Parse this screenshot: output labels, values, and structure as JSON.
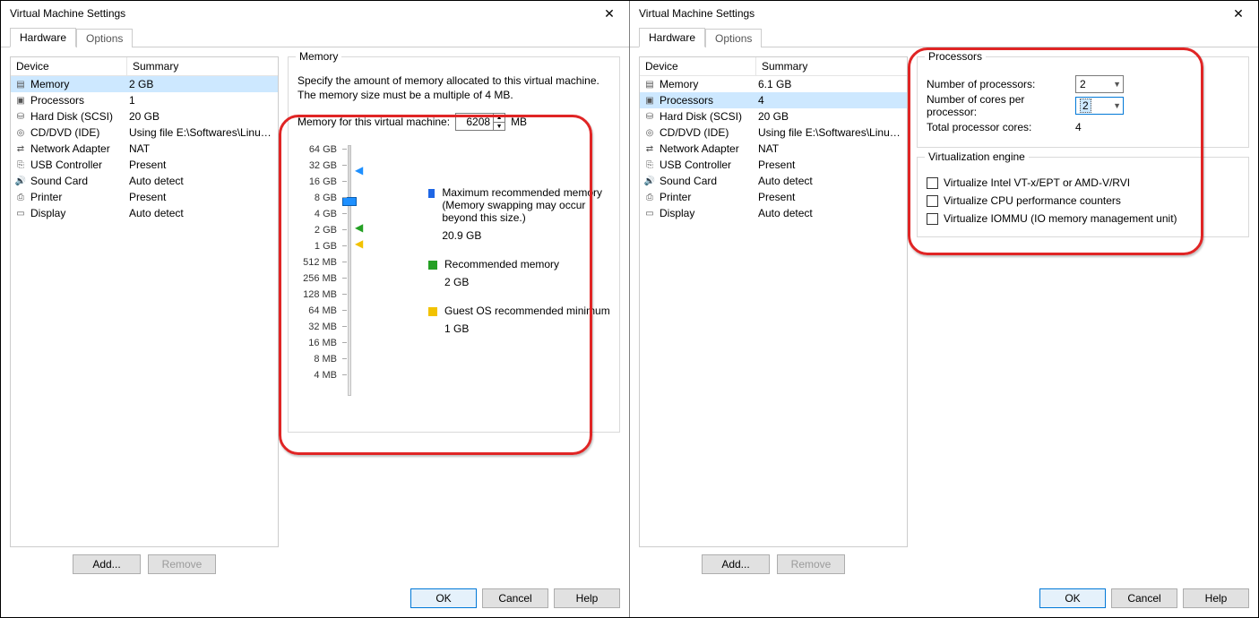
{
  "left": {
    "title": "Virtual Machine Settings",
    "tabs": {
      "hardware": "Hardware",
      "options": "Options"
    },
    "headers": {
      "device": "Device",
      "summary": "Summary"
    },
    "devices": [
      {
        "icon": "memory-icon",
        "name": "Memory",
        "summary": "2 GB",
        "selected": true
      },
      {
        "icon": "cpu-icon",
        "name": "Processors",
        "summary": "1"
      },
      {
        "icon": "disk-icon",
        "name": "Hard Disk (SCSI)",
        "summary": "20 GB"
      },
      {
        "icon": "cd-icon",
        "name": "CD/DVD (IDE)",
        "summary": "Using file E:\\Softwares\\Linux..."
      },
      {
        "icon": "net-icon",
        "name": "Network Adapter",
        "summary": "NAT"
      },
      {
        "icon": "usb-icon",
        "name": "USB Controller",
        "summary": "Present"
      },
      {
        "icon": "sound-icon",
        "name": "Sound Card",
        "summary": "Auto detect"
      },
      {
        "icon": "printer-icon",
        "name": "Printer",
        "summary": "Present"
      },
      {
        "icon": "display-icon",
        "name": "Display",
        "summary": "Auto detect"
      }
    ],
    "buttons": {
      "add": "Add...",
      "remove": "Remove"
    },
    "memory": {
      "legend": "Memory",
      "desc": "Specify the amount of memory allocated to this virtual machine. The memory size must be a multiple of 4 MB.",
      "input_label": "Memory for this virtual machine:",
      "input_value": "6208",
      "unit": "MB",
      "ticks": [
        "64 GB",
        "32 GB",
        "16 GB",
        "8 GB",
        "4 GB",
        "2 GB",
        "1 GB",
        "512 MB",
        "256 MB",
        "128 MB",
        "64 MB",
        "32 MB",
        "16 MB",
        "8 MB",
        "4 MB"
      ],
      "max_label": "Maximum recommended memory",
      "max_note": "(Memory swapping may occur beyond this size.)",
      "max_value": "20.9 GB",
      "rec_label": "Recommended memory",
      "rec_value": "2 GB",
      "min_label": "Guest OS recommended minimum",
      "min_value": "1 GB"
    },
    "footer": {
      "ok": "OK",
      "cancel": "Cancel",
      "help": "Help"
    }
  },
  "right": {
    "title": "Virtual Machine Settings",
    "tabs": {
      "hardware": "Hardware",
      "options": "Options"
    },
    "headers": {
      "device": "Device",
      "summary": "Summary"
    },
    "devices": [
      {
        "icon": "memory-icon",
        "name": "Memory",
        "summary": "6.1 GB"
      },
      {
        "icon": "cpu-icon",
        "name": "Processors",
        "summary": "4",
        "selected": true
      },
      {
        "icon": "disk-icon",
        "name": "Hard Disk (SCSI)",
        "summary": "20 GB"
      },
      {
        "icon": "cd-icon",
        "name": "CD/DVD (IDE)",
        "summary": "Using file E:\\Softwares\\Linux..."
      },
      {
        "icon": "net-icon",
        "name": "Network Adapter",
        "summary": "NAT"
      },
      {
        "icon": "usb-icon",
        "name": "USB Controller",
        "summary": "Present"
      },
      {
        "icon": "sound-icon",
        "name": "Sound Card",
        "summary": "Auto detect"
      },
      {
        "icon": "printer-icon",
        "name": "Printer",
        "summary": "Present"
      },
      {
        "icon": "display-icon",
        "name": "Display",
        "summary": "Auto detect"
      }
    ],
    "buttons": {
      "add": "Add...",
      "remove": "Remove"
    },
    "proc": {
      "legend": "Processors",
      "num_proc_label": "Number of processors:",
      "num_proc_value": "2",
      "cores_label": "Number of cores per processor:",
      "cores_value": "2",
      "total_label": "Total processor cores:",
      "total_value": "4"
    },
    "virt": {
      "legend": "Virtualization engine",
      "opt1": "Virtualize Intel VT-x/EPT or AMD-V/RVI",
      "opt2": "Virtualize CPU performance counters",
      "opt3": "Virtualize IOMMU (IO memory management unit)"
    },
    "footer": {
      "ok": "OK",
      "cancel": "Cancel",
      "help": "Help"
    }
  },
  "icons": {
    "memory-icon": "▤",
    "cpu-icon": "▣",
    "disk-icon": "⛁",
    "cd-icon": "◎",
    "net-icon": "⇄",
    "usb-icon": "⎘",
    "sound-icon": "🔊",
    "printer-icon": "⎙",
    "display-icon": "▭"
  }
}
